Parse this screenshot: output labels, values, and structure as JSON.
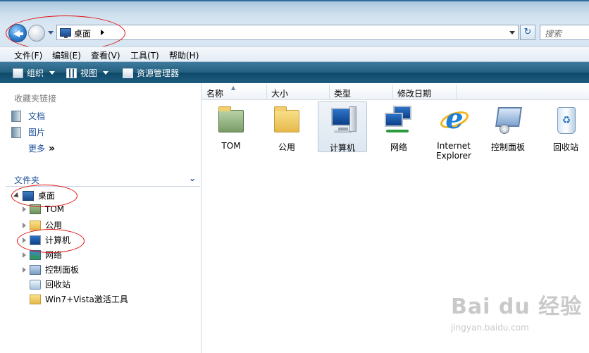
{
  "address_bar": {
    "location": "桌面",
    "search_placeholder": "搜索"
  },
  "menu": {
    "items": [
      "文件(F)",
      "编辑(E)",
      "查看(V)",
      "工具(T)",
      "帮助(H)"
    ]
  },
  "command_bar": {
    "organize": "组织",
    "views": "视图",
    "explorer": "资源管理器"
  },
  "favorites": {
    "title": "收藏夹链接",
    "items": [
      "文档",
      "图片"
    ],
    "more": "更多",
    "more_glyph": "»"
  },
  "folders": {
    "title": "文件夹",
    "root": "桌面",
    "children": [
      "TOM",
      "公用",
      "计算机",
      "网络",
      "控制面板",
      "回收站",
      "Win7+Vista激活工具"
    ]
  },
  "columns": [
    "名称",
    "大小",
    "类型",
    "修改日期"
  ],
  "items": [
    {
      "label": "TOM"
    },
    {
      "label": "公用"
    },
    {
      "label": "计算机"
    },
    {
      "label": "网络"
    },
    {
      "label": "Internet Explorer"
    },
    {
      "label": "控制面板"
    },
    {
      "label": "回收站"
    }
  ],
  "watermark": {
    "main": "Bai du 经验",
    "sub": "jingyan.baidu.com"
  },
  "colors": {
    "link": "#1c4f9a",
    "command_bar": "#24607f",
    "annotation": "#e01010"
  }
}
